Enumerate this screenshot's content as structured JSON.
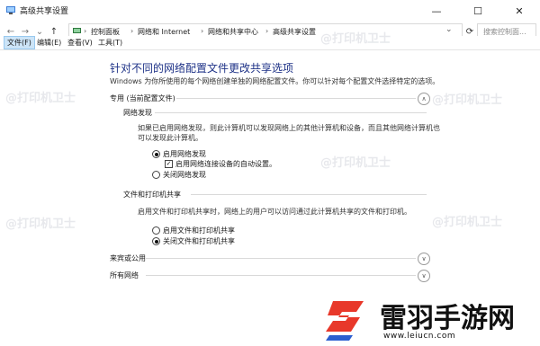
{
  "window": {
    "title": "高级共享设置",
    "minimize_glyph": "—",
    "maximize_glyph": "☐",
    "close_glyph": "✕"
  },
  "nav": {
    "back_glyph": "←",
    "forward_glyph": "→",
    "dropdown_glyph": "⌄",
    "up_glyph": "↑",
    "breadcrumbs": [
      "控制面板",
      "网络和 Internet",
      "网络和共享中心",
      "高级共享设置"
    ],
    "separator": "›",
    "search_placeholder": "搜索控制面..."
  },
  "menu": [
    "文件(F)",
    "编辑(E)",
    "查看(V)",
    "工具(T)"
  ],
  "page": {
    "heading": "针对不同的网络配置文件更改共享选项",
    "description": "Windows 为你所使用的每个网络创建单独的网络配置文件。你可以针对每个配置文件选择特定的选项。",
    "private_profile": {
      "title": "专用 (当前配置文件)",
      "network_discovery": {
        "title": "网络发现",
        "text": "如果已启用网络发现，则此计算机可以发现网络上的其他计算机和设备，而且其他网络计算机也可以发现此计算机。",
        "opt_on": "启用网络发现",
        "opt_auto": "启用网络连接设备的自动设置。",
        "opt_off": "关闭网络发现"
      },
      "file_printer_sharing": {
        "title": "文件和打印机共享",
        "text": "启用文件和打印机共享时，网络上的用户可以访问通过此计算机共享的文件和打印机。",
        "opt_on": "启用文件和打印机共享",
        "opt_off": "关闭文件和打印机共享"
      }
    },
    "guest_profile": {
      "title": "来宾或公用"
    },
    "all_networks": {
      "title": "所有网络"
    }
  },
  "watermark": "@打印机卫士",
  "brand": {
    "name": "雷羽手游网",
    "url": "www.leiucn.com"
  },
  "colors": {
    "heading": "#1e3287",
    "brand_red": "#e8382a",
    "brand_blue": "#2b5fd0"
  }
}
